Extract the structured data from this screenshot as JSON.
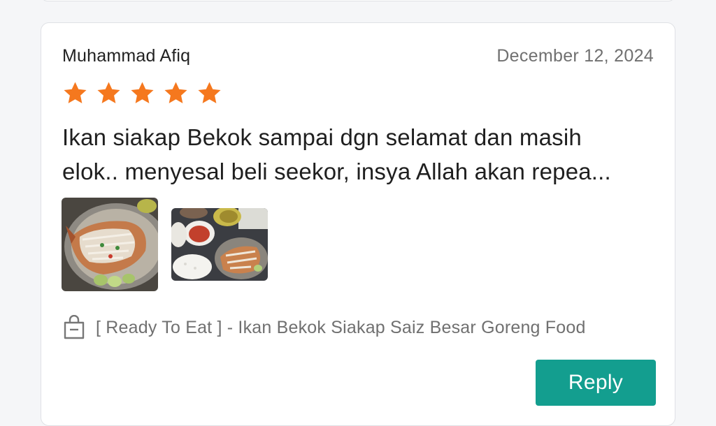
{
  "review": {
    "author": "Muhammad Afiq",
    "date": "December 12, 2024",
    "rating": 5,
    "rating_max": 5,
    "star_color": "#f5781e",
    "text_line_1": "Ikan siakap Bekok sampai dgn selamat dan masih",
    "text_line_2": "elok.. menyesal beli seekor, insya Allah akan repea...",
    "photos": [
      {
        "icon": "food-photo"
      },
      {
        "icon": "food-photo"
      }
    ],
    "product_icon": "shopping-bag-icon",
    "product": "[ Ready To Eat ] - Ikan Bekok Siakap Saiz Besar Goreng Food"
  },
  "actions": {
    "reply_label": "Reply",
    "reply_color": "#139e8f"
  }
}
